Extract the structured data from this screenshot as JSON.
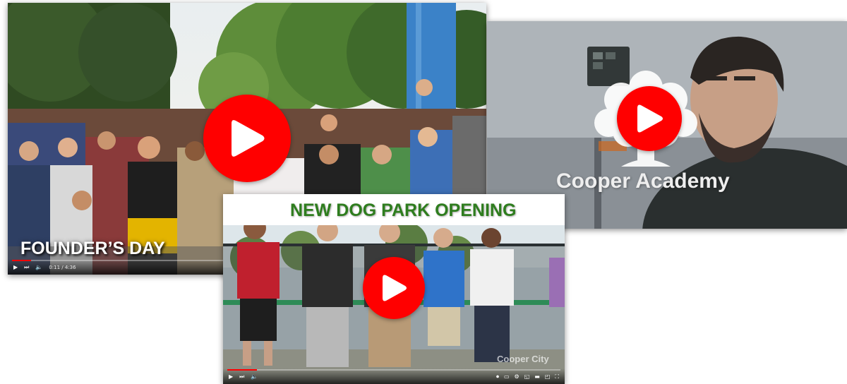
{
  "colors": {
    "play_button": "#ff0000",
    "progress_fill": "#ff0000",
    "dog_park_title": "#2e7d1e"
  },
  "videos": [
    {
      "title": "FOUNDER’S DAY",
      "time": "0:11 / 4:36",
      "progress_fraction": 0.04,
      "icons": [
        "play-icon",
        "next-icon",
        "volume-icon"
      ]
    },
    {
      "title": "Cooper Academy",
      "icons": [
        "tree-logo-icon"
      ]
    },
    {
      "title": "NEW DOG PARK OPENING",
      "watermark": "Cooper City",
      "progress_fraction": 0.09,
      "icons": [
        "play-icon",
        "next-icon",
        "volume-icon",
        "autoplay-icon",
        "subtitles-icon",
        "settings-icon",
        "miniplayer-icon",
        "theater-icon",
        "cast-icon",
        "fullscreen-icon"
      ]
    }
  ]
}
